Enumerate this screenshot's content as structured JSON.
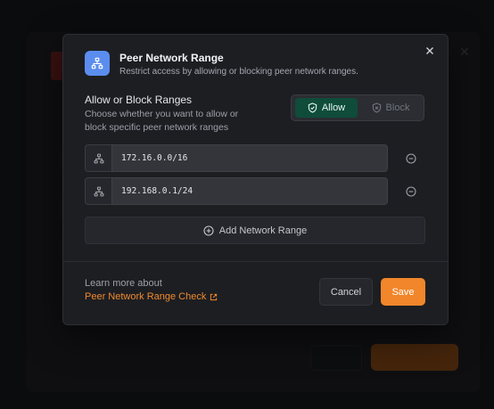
{
  "modal": {
    "title": "Peer Network Range",
    "subtitle": "Restrict access by allowing or blocking peer network ranges.",
    "header_icon": "network-icon",
    "close_icon": "close-icon"
  },
  "mode": {
    "title": "Allow or Block Ranges",
    "description": "Choose whether you want to allow or block specific peer network ranges",
    "options": [
      {
        "label": "Allow",
        "icon": "shield-check-icon",
        "selected": true
      },
      {
        "label": "Block",
        "icon": "shield-x-icon",
        "selected": false
      }
    ]
  },
  "ranges": [
    {
      "value": "172.16.0.0/16",
      "icon": "network-icon",
      "remove_icon": "minus-circle-icon"
    },
    {
      "value": "192.168.0.1/24",
      "icon": "network-icon",
      "remove_icon": "minus-circle-icon"
    }
  ],
  "add_button": {
    "label": "Add Network Range",
    "icon": "plus-circle-icon"
  },
  "footer": {
    "learn_more": "Learn more about",
    "link_label": "Peer Network Range Check",
    "link_icon": "external-link-icon",
    "cancel_label": "Cancel",
    "save_label": "Save"
  },
  "colors": {
    "accent": "#f1862b",
    "allow_selected": "#0f4c3a",
    "header_icon_bg": "#5b8def",
    "modal_bg": "#1d1e22"
  }
}
